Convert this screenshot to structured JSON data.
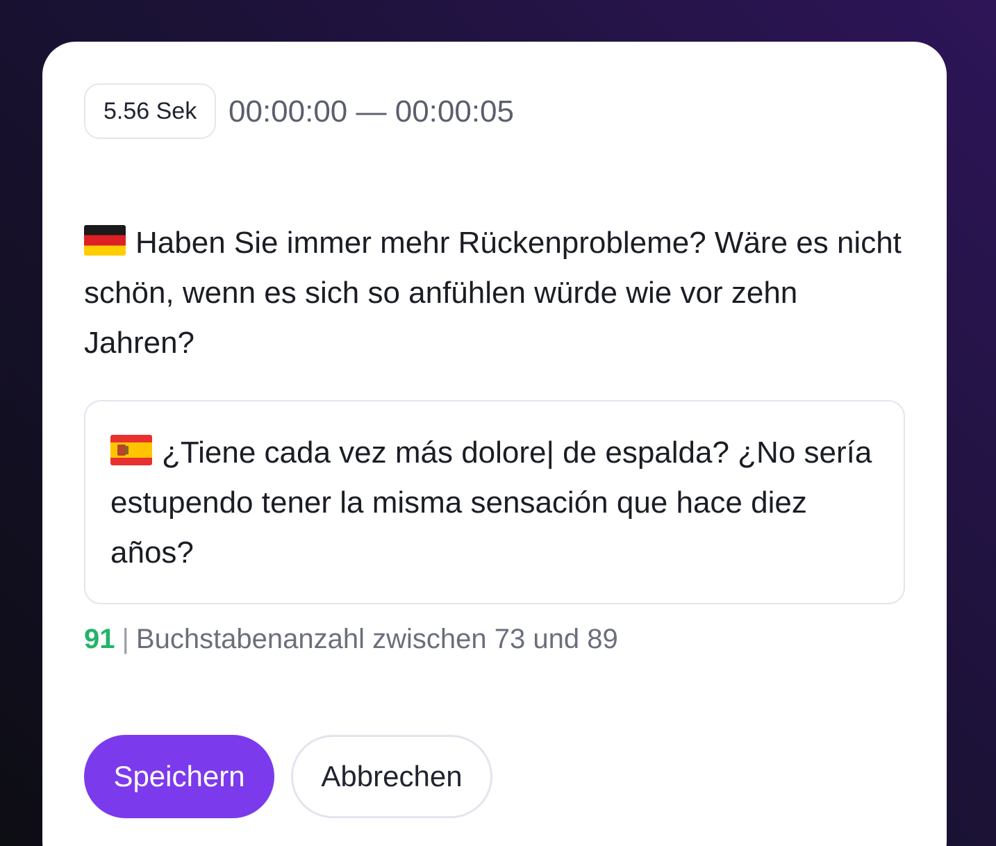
{
  "segment": {
    "duration_label": "5.56 Sek",
    "timecode": "00:00:00 — 00:00:05"
  },
  "source": {
    "flag": "germany-flag",
    "text": "Haben Sie immer mehr Rückenprobleme? Wäre es nicht schön, wenn es sich so anfühlen würde wie vor zehn Jahren?"
  },
  "translation": {
    "flag": "spain-flag",
    "text": "¿Tiene cada vez más dolore| de espalda? ¿No sería estupendo tener la misma sensación que hace diez años?"
  },
  "char_info": {
    "count": "91",
    "separator": "|",
    "hint": "Buchstabenanzahl zwischen 73 und 89"
  },
  "actions": {
    "save_label": "Speichern",
    "cancel_label": "Abbrechen"
  },
  "colors": {
    "accent": "#7c3aed",
    "count_ok": "#22b468"
  }
}
